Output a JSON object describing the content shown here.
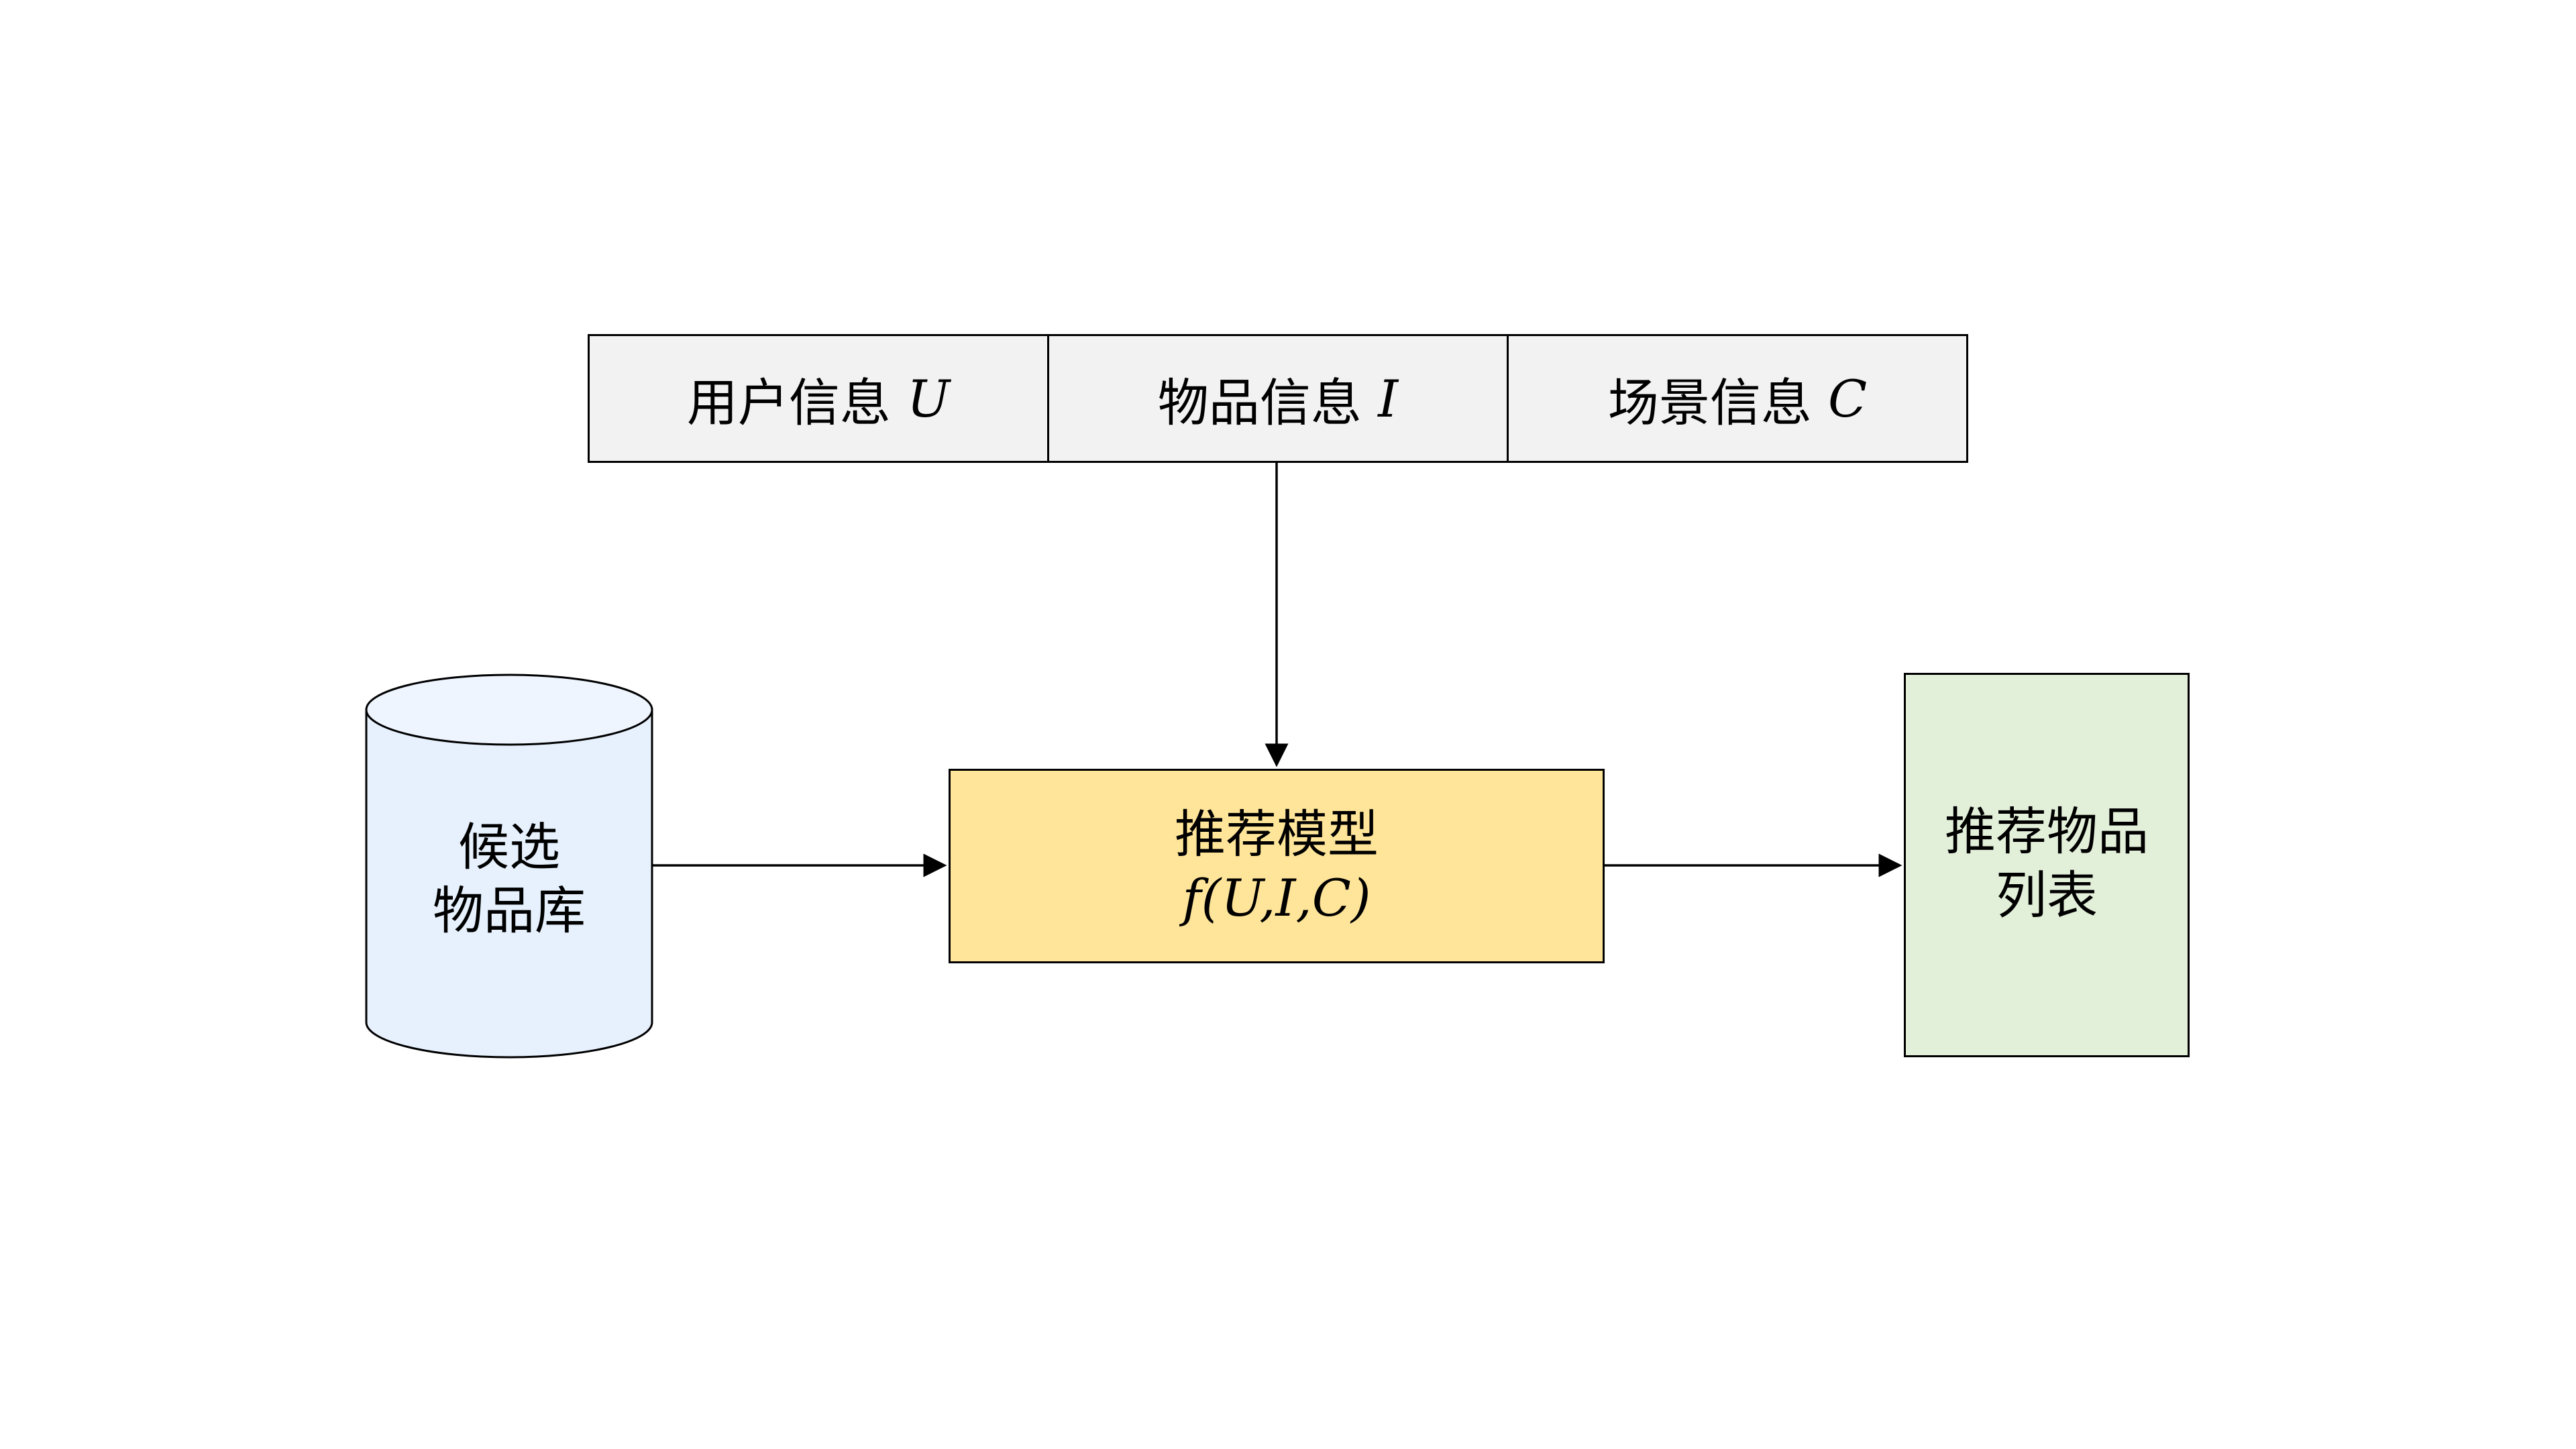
{
  "info_bar": {
    "cells": [
      {
        "label": "用户信息",
        "symbol": "U"
      },
      {
        "label": "物品信息",
        "symbol": "I"
      },
      {
        "label": "场景信息",
        "symbol": "C"
      }
    ]
  },
  "database": {
    "label_line1": "候选",
    "label_line2": "物品库"
  },
  "model": {
    "title": "推荐模型",
    "formula": "f(U,I,C)"
  },
  "output": {
    "label_line1": "推荐物品",
    "label_line2": "列表"
  },
  "colors": {
    "info_bar_fill": "#f2f2f2",
    "model_fill": "#ffe599",
    "output_fill": "#e2efd9",
    "database_top_fill": "#eef5ff",
    "database_body_fill": "#e6f1fd",
    "stroke": "#000000"
  }
}
